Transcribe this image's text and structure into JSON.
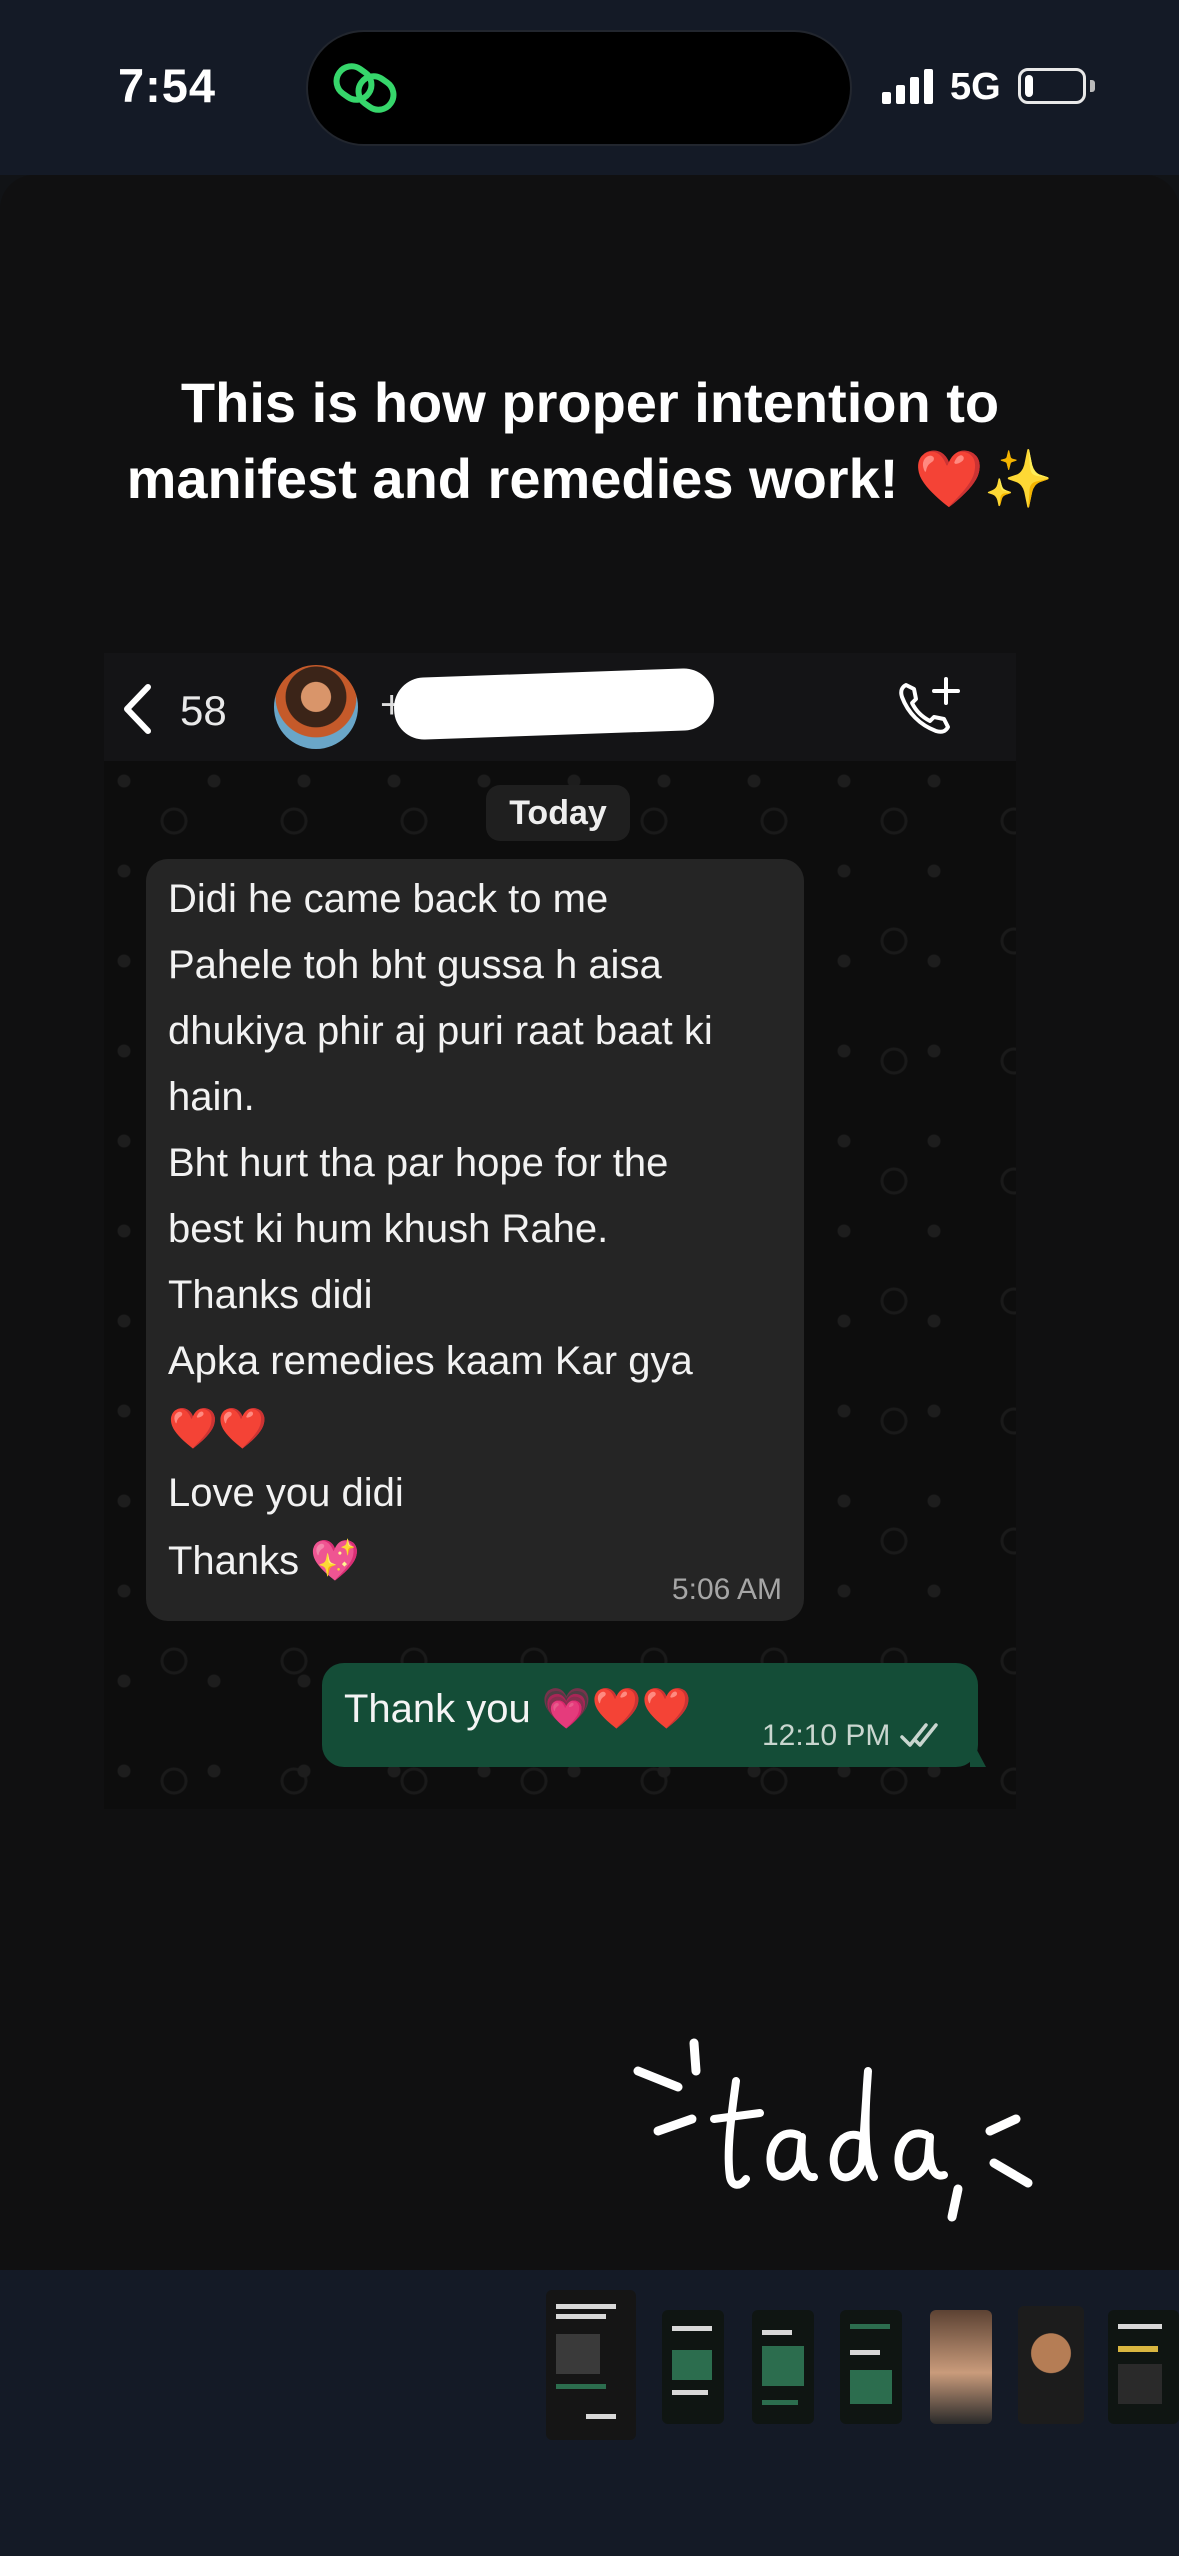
{
  "status_bar": {
    "time": "7:54",
    "network": "5G",
    "battery_level": 0.15,
    "island_app_color": "#36d66b"
  },
  "story": {
    "headline": "This is how proper intention to manifest and remedies work! ❤️✨",
    "sticker_text": "tada"
  },
  "chat": {
    "unread_count": "58",
    "contact_visible": "+9",
    "date_label": "Today",
    "incoming": {
      "lines": [
        "Didi he came back to me",
        "Pahele toh bht gussa h aisa",
        "dhukiya phir aj puri raat baat ki",
        "hain.",
        "Bht hurt tha par hope for the",
        "best ki hum khush Rahe.",
        "Thanks didi",
        "Apka remedies kaam Kar gya",
        "❤️❤️",
        "Love you didi",
        "Thanks 💖"
      ],
      "time": "5:06 AM"
    },
    "outgoing": {
      "text": "Thank you 💗❤️❤️",
      "time": "12:10 PM"
    },
    "colors": {
      "incoming_bubble": "#252525",
      "outgoing_bubble": "#144d37"
    }
  },
  "thumbnails": {
    "count": 7,
    "active_index": 0
  }
}
